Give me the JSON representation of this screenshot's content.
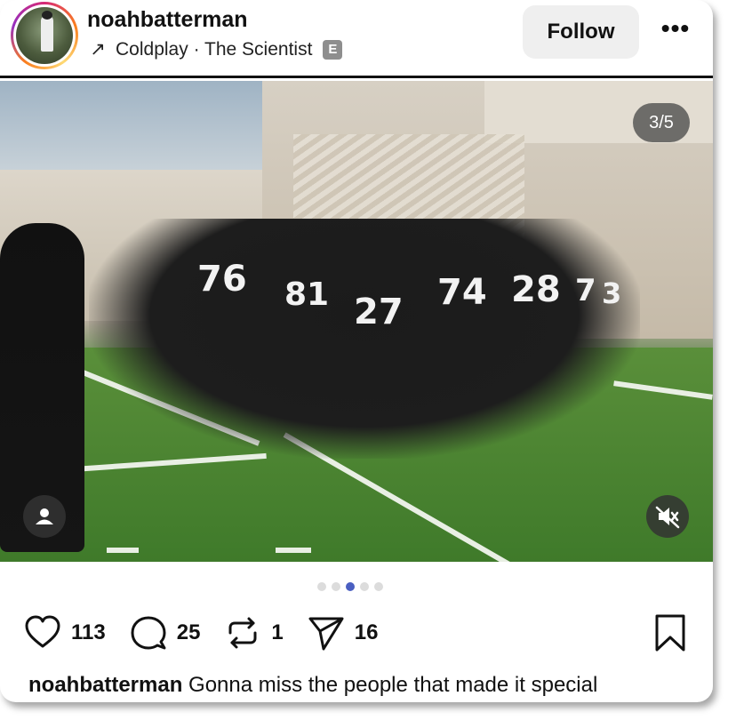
{
  "post": {
    "username": "noahbatterman",
    "music": {
      "artist": "Coldplay",
      "separator": "·",
      "song": "The Scientist",
      "explicit_badge": "E"
    },
    "follow_label": "Follow",
    "more_label": "•••",
    "media": {
      "counter": "3/5",
      "jersey_numbers": [
        "76",
        "81",
        "27",
        "74",
        "28",
        "7",
        "3"
      ]
    },
    "carousel": {
      "total": 5,
      "active_index": 2
    },
    "actions": {
      "likes": "113",
      "comments": "25",
      "reposts": "1",
      "shares": "16"
    },
    "caption": {
      "username": "noahbatterman",
      "text": "Gonna miss the people that made it special"
    }
  },
  "icons": {
    "music_arrow": "arrow-up-right-icon",
    "like": "heart-icon",
    "comment": "comment-icon",
    "repost": "repost-icon",
    "share": "send-icon",
    "save": "bookmark-icon",
    "tags": "user-tag-icon",
    "mute": "speaker-muted-icon"
  },
  "colors": {
    "active_dot": "#4a5fc1",
    "follow_bg": "#efefef",
    "explicit_bg": "#8e8e8e"
  }
}
